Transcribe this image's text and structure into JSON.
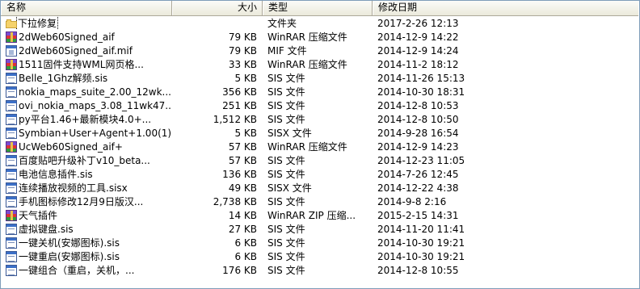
{
  "columns": {
    "name": "名称",
    "size": "大小",
    "type": "类型",
    "date": "修改日期"
  },
  "files": [
    {
      "name": "下拉修复",
      "size": "",
      "type": "文件夹",
      "date": "2017-2-26 12:13",
      "icon": "folder-icon"
    },
    {
      "name": "2dWeb60Signed_aif",
      "size": "79 KB",
      "type": "WinRAR 压缩文件",
      "date": "2014-12-9 14:22",
      "icon": "rar-archive-icon"
    },
    {
      "name": "2dWeb60Signed_aif.mif",
      "size": "79 KB",
      "type": "MIF 文件",
      "date": "2014-12-9 14:24",
      "icon": "mif-file-icon"
    },
    {
      "name": "1511固件支持WML网页格...",
      "size": "33 KB",
      "type": "WinRAR 压缩文件",
      "date": "2014-11-2 18:12",
      "icon": "rar-archive-icon"
    },
    {
      "name": "Belle_1Ghz解频.sis",
      "size": "5 KB",
      "type": "SIS 文件",
      "date": "2014-11-26 15:13",
      "icon": "sis-file-icon"
    },
    {
      "name": "nokia_maps_suite_2.00_12wk...",
      "size": "356 KB",
      "type": "SIS 文件",
      "date": "2014-10-30 18:31",
      "icon": "sis-file-icon"
    },
    {
      "name": "ovi_nokia_maps_3.08_11wk47...",
      "size": "251 KB",
      "type": "SIS 文件",
      "date": "2014-12-8 10:53",
      "icon": "sis-file-icon"
    },
    {
      "name": "py平台1.46+最新模块4.0+...",
      "size": "1,512 KB",
      "type": "SIS 文件",
      "date": "2014-12-8 10:50",
      "icon": "sis-file-icon"
    },
    {
      "name": "Symbian+User+Agent+1.00(1)...",
      "size": "5 KB",
      "type": "SISX 文件",
      "date": "2014-9-28 16:54",
      "icon": "sis-file-icon"
    },
    {
      "name": "UcWeb60Signed_aif+",
      "size": "57 KB",
      "type": "WinRAR 压缩文件",
      "date": "2014-12-9 14:23",
      "icon": "rar-archive-icon"
    },
    {
      "name": "百度贴吧升级补丁v10_beta...",
      "size": "57 KB",
      "type": "SIS 文件",
      "date": "2014-12-23 11:05",
      "icon": "sis-file-icon"
    },
    {
      "name": "电池信息插件.sis",
      "size": "136 KB",
      "type": "SIS 文件",
      "date": "2014-7-26 12:45",
      "icon": "sis-file-icon"
    },
    {
      "name": "连续播放视频的工具.sisx",
      "size": "49 KB",
      "type": "SISX 文件",
      "date": "2014-12-22 4:38",
      "icon": "sis-file-icon"
    },
    {
      "name": "手机图标修改12月9日版汉...",
      "size": "2,738 KB",
      "type": "SIS 文件",
      "date": "2014-9-8 2:16",
      "icon": "sis-file-icon"
    },
    {
      "name": "天气插件",
      "size": "14 KB",
      "type": "WinRAR ZIP 压缩...",
      "date": "2015-2-15 14:31",
      "icon": "rar-archive-icon"
    },
    {
      "name": "虚拟键盘.sis",
      "size": "27 KB",
      "type": "SIS 文件",
      "date": "2014-11-20 11:41",
      "icon": "sis-file-icon"
    },
    {
      "name": "一键关机(安娜图标).sis",
      "size": "6 KB",
      "type": "SIS 文件",
      "date": "2014-10-30 19:21",
      "icon": "sis-file-icon"
    },
    {
      "name": "一键重启(安娜图标).sis",
      "size": "6 KB",
      "type": "SIS 文件",
      "date": "2014-10-30 19:21",
      "icon": "sis-file-icon"
    },
    {
      "name": "一键组合（重启，关机，...",
      "size": "176 KB",
      "type": "SIS 文件",
      "date": "2014-12-8 10:55",
      "icon": "sis-file-icon"
    }
  ]
}
